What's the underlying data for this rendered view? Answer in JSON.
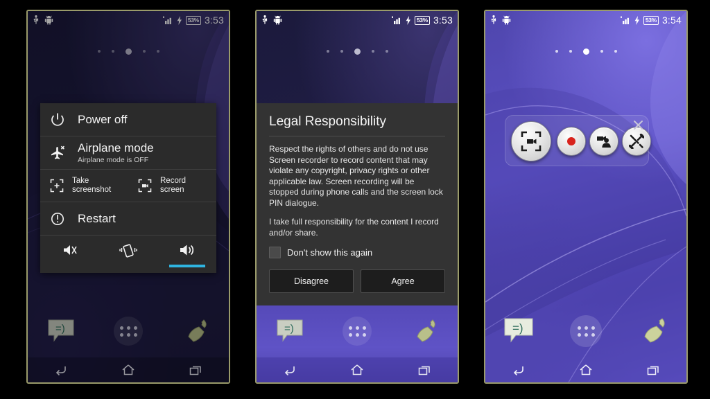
{
  "meta": {
    "scene": "Android Xperia Screen recorder flow — three phone screens side by side"
  },
  "phone1": {
    "status": {
      "usb_icon": "usb-icon",
      "android_icon": "android-robot-icon",
      "signal_icon": "signal-bars-icon",
      "charging_icon": "charging-bolt-icon",
      "battery": "53%",
      "time": "3:53"
    },
    "page_dots": {
      "count": 5,
      "active_index": 2
    },
    "power_menu": {
      "power_off": {
        "label": "Power off",
        "icon": "power-icon"
      },
      "airplane": {
        "label": "Airplane mode",
        "sub": "Airplane mode is OFF",
        "icon": "airplane-icon"
      },
      "screenshot": {
        "label": "Take\nscreenshot",
        "line1": "Take",
        "line2": "screenshot",
        "icon": "screenshot-frame-icon"
      },
      "record": {
        "label": "Record\nscreen",
        "line1": "Record",
        "line2": "screen",
        "icon": "record-screen-frame-icon"
      },
      "restart": {
        "label": "Restart",
        "icon": "restart-icon"
      },
      "modes": [
        {
          "name": "silent",
          "icon": "mute-icon",
          "selected": false
        },
        {
          "name": "vibrate",
          "icon": "vibrate-icon",
          "selected": false
        },
        {
          "name": "sound",
          "icon": "speaker-icon",
          "selected": true
        }
      ],
      "accent": "#2fb4e0"
    },
    "dock": [
      {
        "name": "messaging",
        "icon": "messaging-bubble-icon"
      },
      {
        "name": "app-drawer",
        "icon": "app-drawer-icon"
      },
      {
        "name": "phone",
        "icon": "phone-handset-icon"
      }
    ],
    "nav": [
      {
        "name": "back",
        "icon": "back-arrow-icon"
      },
      {
        "name": "home",
        "icon": "home-icon"
      },
      {
        "name": "recents",
        "icon": "recents-icon"
      }
    ]
  },
  "phone2": {
    "status": {
      "usb_icon": "usb-icon",
      "android_icon": "android-robot-icon",
      "signal_icon": "signal-bars-icon",
      "charging_icon": "charging-bolt-icon",
      "battery": "53%",
      "time": "3:53"
    },
    "page_dots": {
      "count": 5,
      "active_index": 2
    },
    "dialog": {
      "title": "Legal Responsibility",
      "body": "Respect the rights of others and do not use Screen recorder to record content that may violate any copyright, privacy rights or other applicable law. Screen recording will be stopped during phone calls and the screen lock PIN dialogue.",
      "body2": "I take full responsibility for the content I record and/or share.",
      "checkbox_label": "Don't show this again",
      "checkbox_checked": false,
      "disagree": "Disagree",
      "agree": "Agree"
    },
    "dock": [
      {
        "name": "messaging",
        "icon": "messaging-bubble-icon"
      },
      {
        "name": "app-drawer",
        "icon": "app-drawer-icon"
      },
      {
        "name": "phone",
        "icon": "phone-handset-icon"
      }
    ],
    "nav": [
      {
        "name": "back",
        "icon": "back-arrow-icon"
      },
      {
        "name": "home",
        "icon": "home-icon"
      },
      {
        "name": "recents",
        "icon": "recents-icon"
      }
    ]
  },
  "phone3": {
    "status": {
      "usb_icon": "usb-icon",
      "android_icon": "android-robot-icon",
      "signal_icon": "signal-bars-icon",
      "charging_icon": "charging-bolt-icon",
      "battery": "53%",
      "time": "3:54"
    },
    "page_dots": {
      "count": 5,
      "active_index": 2
    },
    "recorder_bar": {
      "buttons": [
        {
          "name": "record-area",
          "icon": "record-frame-camcorder-icon"
        },
        {
          "name": "start-record",
          "icon": "red-record-dot-icon",
          "color": "#d8231d"
        },
        {
          "name": "front-camera",
          "icon": "camera-person-icon"
        },
        {
          "name": "settings",
          "icon": "tools-wrench-screwdriver-icon"
        }
      ],
      "close": {
        "name": "close",
        "icon": "close-x-icon"
      }
    },
    "dock": [
      {
        "name": "messaging",
        "icon": "messaging-bubble-icon"
      },
      {
        "name": "app-drawer",
        "icon": "app-drawer-icon"
      },
      {
        "name": "phone",
        "icon": "phone-handset-icon"
      }
    ],
    "nav": [
      {
        "name": "back",
        "icon": "back-arrow-icon"
      },
      {
        "name": "home",
        "icon": "home-icon"
      },
      {
        "name": "recents",
        "icon": "recents-icon"
      }
    ]
  }
}
